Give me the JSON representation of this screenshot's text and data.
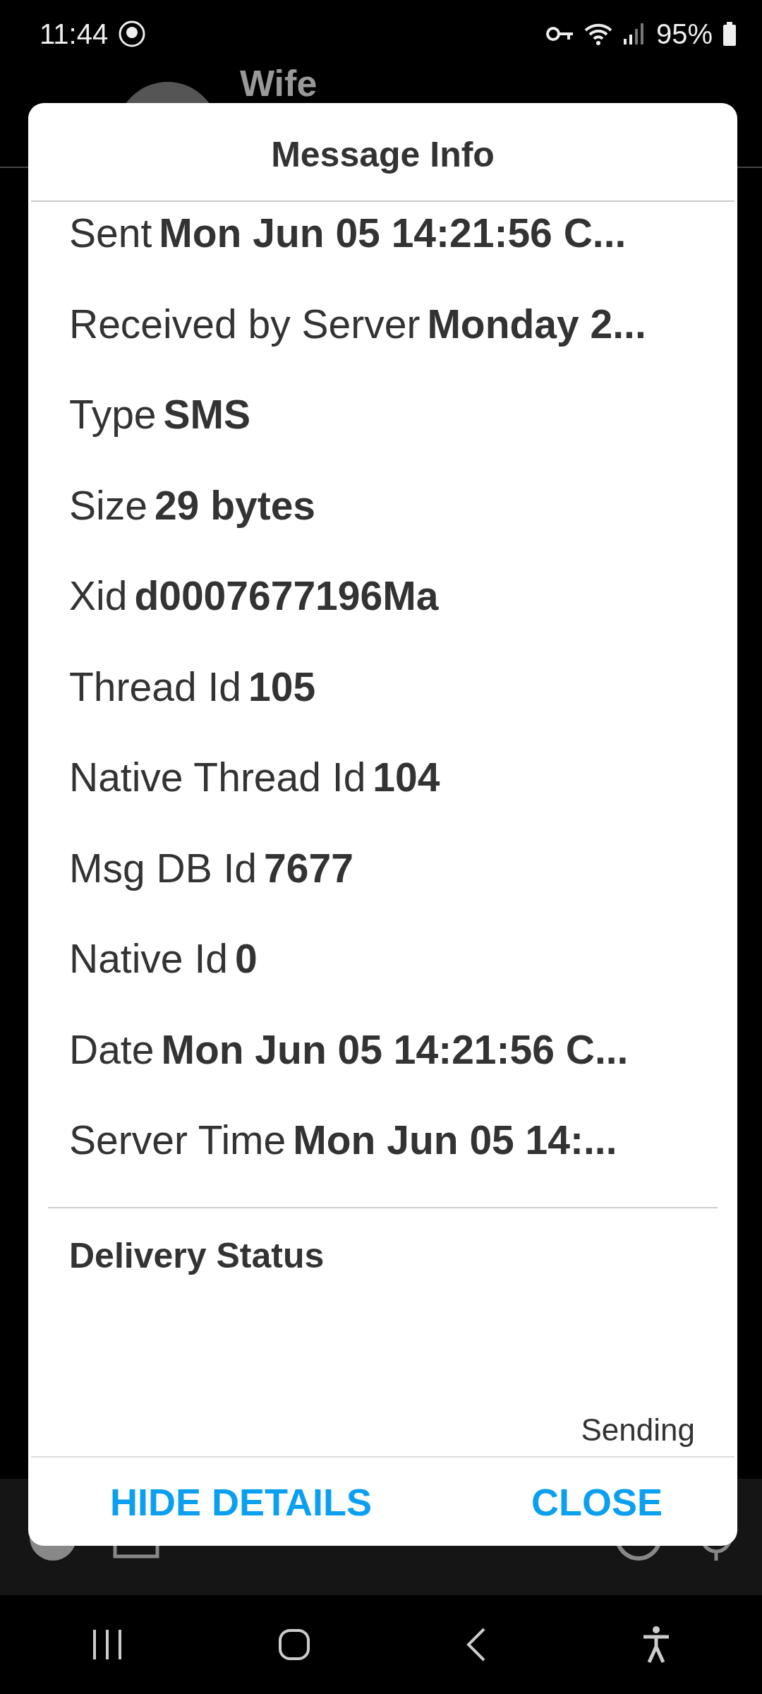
{
  "status_bar": {
    "time": "11:44",
    "battery": "95%"
  },
  "conversation": {
    "contact": "Wife"
  },
  "dialog": {
    "title": "Message Info",
    "rows": [
      {
        "label": "Sent",
        "value": "Mon Jun 05 14:21:56 C..."
      },
      {
        "label": "Received by Server",
        "value": "Monday 2..."
      },
      {
        "label": "Type",
        "value": "SMS"
      },
      {
        "label": "Size",
        "value": "29 bytes"
      },
      {
        "label": "Xid",
        "value": "d0007677196Ma"
      },
      {
        "label": "Thread Id",
        "value": "105"
      },
      {
        "label": "Native Thread Id",
        "value": "104"
      },
      {
        "label": "Msg DB Id",
        "value": "7677"
      },
      {
        "label": "Native Id",
        "value": "0"
      },
      {
        "label": "Date",
        "value": "Mon Jun 05 14:21:56 C..."
      },
      {
        "label": "Server Time",
        "value": "Mon Jun 05 14:..."
      }
    ],
    "section_title": "Delivery Status",
    "delivery_status": "Sending",
    "buttons": [
      "HIDE DETAILS",
      "CLOSE"
    ]
  }
}
